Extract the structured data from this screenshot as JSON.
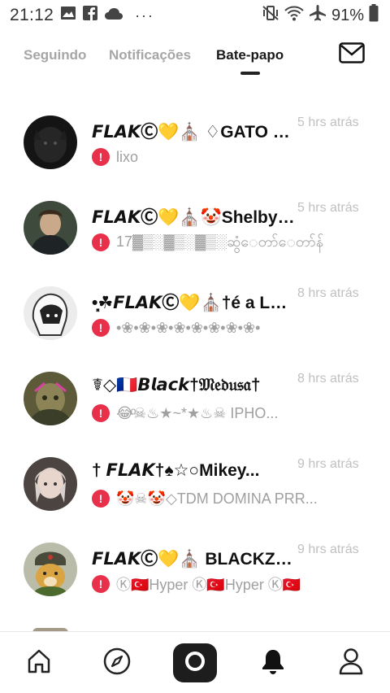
{
  "status_bar": {
    "time": "21:12",
    "more_indicator": "···",
    "battery": "91%",
    "icons": [
      "image-icon",
      "facebook-icon",
      "cloud-icon",
      "vibrate-icon",
      "wifi-icon",
      "airplane-icon",
      "battery-icon"
    ]
  },
  "tabs": [
    {
      "label": "Seguindo",
      "active": false
    },
    {
      "label": "Notificações",
      "active": false
    },
    {
      "label": "Bate-papo",
      "active": true
    }
  ],
  "chats": [
    {
      "name": "𝙁𝙇𝘼𝙆Ⓒ💛⛪ ♢GATO ⓄⓃ...",
      "time": "5 hrs atrás",
      "preview": "lixo",
      "avatar_color": "#1b1b1b"
    },
    {
      "name": "𝙁𝙇𝘼𝙆Ⓒ💛⛪🤡Shelby😈🥶",
      "time": "5 hrs atrás",
      "preview": "17▓▒░▓▒░▓▒░ဆွံေတာ်ေတာ်န်",
      "avatar_color": "#4a5446"
    },
    {
      "name": "•͓͙☘𝙁𝙇𝘼𝙆Ⓒ💛⛪†é a Lul...",
      "time": "8 hrs atrás",
      "preview": "•❀•❀•❀•❀•❀•❀•❀•❀•",
      "avatar_color": "#d7d7d7"
    },
    {
      "name": "☤◇🇫🇷𝘽𝙡𝙖𝙘𝙠†𝔐𝔢𝔡𝔲𝔰𝔞†",
      "time": "8 hrs atrás",
      "preview": "😂ͦ☠♨★~*★♨☠ IPHO...",
      "avatar_color": "#6b6b3f"
    },
    {
      "name": "† 𝙁𝙇𝘼𝙆†♠☆○Mikey...",
      "time": "9 hrs atrás",
      "preview": "🤡☠🤡◇TDM DOMINA PRR...",
      "avatar_color": "#5a4f4a"
    },
    {
      "name": "𝙁𝙇𝘼𝙆Ⓒ💛⛪ BLACKZIN...",
      "time": "9 hrs atrás",
      "preview": "Ⓚ🇹🇷Hyper Ⓚ🇹🇷Hyper Ⓚ🇹🇷",
      "avatar_color": "#7c8a5a"
    }
  ],
  "bottom_nav": {
    "items": [
      "home-icon",
      "compass-icon",
      "camera-icon",
      "bell-icon",
      "profile-icon"
    ]
  },
  "colors": {
    "alert": "#e8304a",
    "time_text": "#c0c0c0",
    "inactive_tab": "#a6a6a6"
  }
}
